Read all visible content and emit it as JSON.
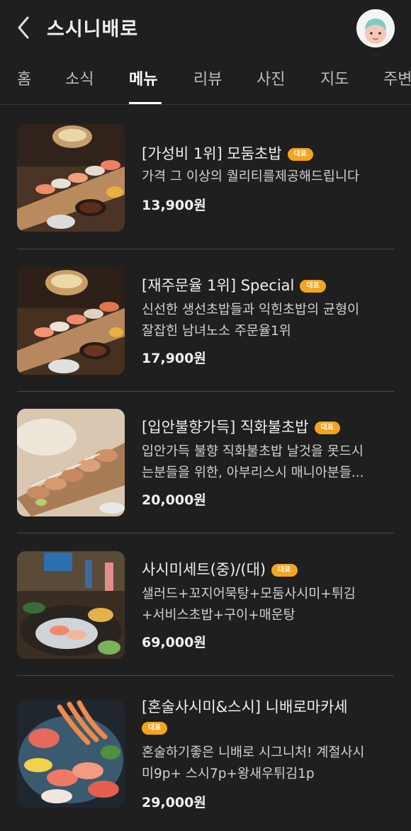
{
  "header": {
    "title": "스시니배로",
    "back_icon": "chevron-left-icon",
    "avatar_label": "my"
  },
  "tabs": [
    {
      "label": "홈"
    },
    {
      "label": "소식"
    },
    {
      "label": "메뉴"
    },
    {
      "label": "리뷰"
    },
    {
      "label": "사진"
    },
    {
      "label": "지도"
    },
    {
      "label": "주변"
    }
  ],
  "active_tab": "메뉴",
  "menu": [
    {
      "name": "[가성비 1위] 모둠초밥",
      "badge": "대표",
      "desc": [
        "가격 그 이상의 퀄리티를제공해드립니다"
      ],
      "price": "13,900원"
    },
    {
      "name": "[재주문율 1위] Special",
      "badge": "대표",
      "desc": [
        "신선한 생선초밥들과 익힌초밥의 균형이",
        "잘잡힌 남녀노소 주문율1위"
      ],
      "price": "17,900원"
    },
    {
      "name": "[입안불향가득] 직화불초밥",
      "badge": "대표",
      "desc": [
        "입안가득 불향 직화불초밥 날것을 못드시",
        "는분들을 위한, 아부리스시 매니아분들..."
      ],
      "price": "20,000원"
    },
    {
      "name": "사시미세트(중)/(대)",
      "badge": "대표",
      "desc": [
        "샐러드+꼬지어묵탕+모둠사시미+튀김",
        "+서비스초밥+구이+매운탕"
      ],
      "price": "69,000원"
    },
    {
      "name": "[혼술사시미&스시] 니배로마카세",
      "badge": "대표",
      "desc": [
        "혼술하기좋은 니배로 시그니처! 계절사시",
        "미9p+ 스시7p+왕새우튀김1p"
      ],
      "price": "29,000원"
    }
  ],
  "colors": {
    "badge": "#f2a51f",
    "background": "#1f1f1f"
  }
}
